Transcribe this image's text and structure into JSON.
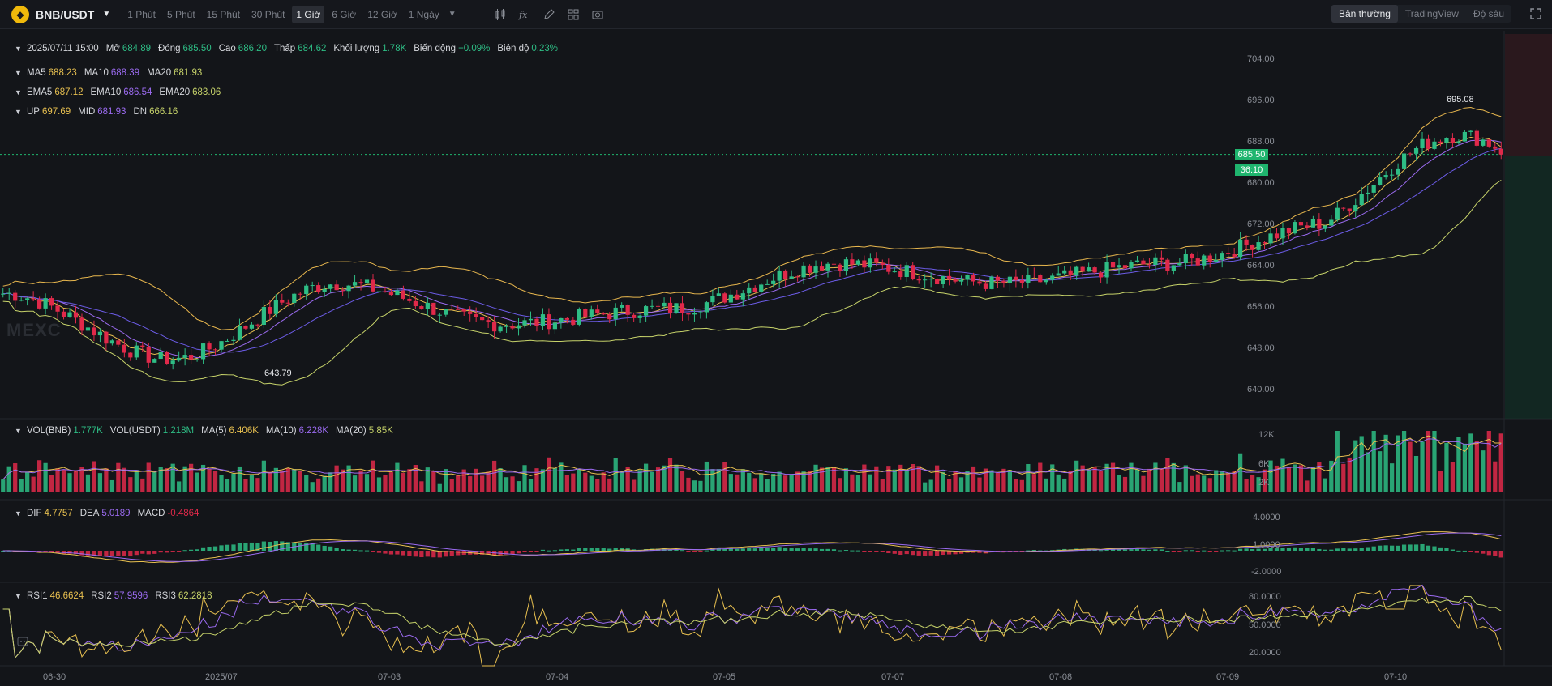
{
  "toolbar": {
    "coin_icon": "bnb-coin-icon",
    "pair": "BNB/USDT",
    "intervals": [
      {
        "label": "1 Phút",
        "active": false
      },
      {
        "label": "5 Phút",
        "active": false
      },
      {
        "label": "15 Phút",
        "active": false
      },
      {
        "label": "30 Phút",
        "active": false
      },
      {
        "label": "1 Giờ",
        "active": true
      },
      {
        "label": "6 Giờ",
        "active": false
      },
      {
        "label": "12 Giờ",
        "active": false
      },
      {
        "label": "1 Ngày",
        "active": false
      }
    ],
    "view_tabs": [
      {
        "label": "Bản thường",
        "active": true
      },
      {
        "label": "TradingView",
        "active": false
      },
      {
        "label": "Độ sâu",
        "active": false
      }
    ]
  },
  "ohlc": {
    "datetime": "2025/07/11 15:00",
    "open_label": "Mở",
    "open": "684.89",
    "close_label": "Đóng",
    "close": "685.50",
    "high_label": "Cao",
    "high": "686.20",
    "low_label": "Thấp",
    "low": "684.62",
    "volume_label": "Khối lượng",
    "volume": "1.78K",
    "change_label": "Biến động",
    "change": "+0.09%",
    "amplitude_label": "Biên độ",
    "amplitude": "0.23%"
  },
  "ma": {
    "ma5_label": "MA5",
    "ma5": "688.23",
    "ma10_label": "MA10",
    "ma10": "688.39",
    "ma20_label": "MA20",
    "ma20": "681.93"
  },
  "ema": {
    "ema5_label": "EMA5",
    "ema5": "687.12",
    "ema10_label": "EMA10",
    "ema10": "686.54",
    "ema20_label": "EMA20",
    "ema20": "683.06"
  },
  "boll": {
    "up_label": "UP",
    "up": "697.69",
    "mid_label": "MID",
    "mid": "681.93",
    "dn_label": "DN",
    "dn": "666.16"
  },
  "price_axis": [
    "704.00",
    "696.00",
    "688.00",
    "680.00",
    "672.00",
    "664.00",
    "656.00",
    "648.00",
    "640.00"
  ],
  "current_price": "685.50",
  "countdown": "36:10",
  "high_marker": "695.08",
  "low_marker": "643.79",
  "watermark": "MEXC",
  "volume": {
    "vol_bnb_label": "VOL(BNB)",
    "vol_bnb": "1.777K",
    "vol_usdt_label": "VOL(USDT)",
    "vol_usdt": "1.218M",
    "ma5_label": "MA(5)",
    "ma5": "6.406K",
    "ma10_label": "MA(10)",
    "ma10": "6.228K",
    "ma20_label": "MA(20)",
    "ma20": "5.85K",
    "axis": [
      "12K",
      "6K",
      "2K"
    ]
  },
  "macd": {
    "dif_label": "DIF",
    "dif": "4.7757",
    "dea_label": "DEA",
    "dea": "5.0189",
    "macd_label": "MACD",
    "macd": "-0.4864",
    "axis": [
      "4.0000",
      "1.0000",
      "-2.0000"
    ]
  },
  "rsi": {
    "rsi1_label": "RSI1",
    "rsi1": "46.6624",
    "rsi2_label": "RSI2",
    "rsi2": "57.9596",
    "rsi3_label": "RSI3",
    "rsi3": "62.2818",
    "axis": [
      "80.0000",
      "50.0000",
      "20.0000"
    ]
  },
  "time_axis": [
    "06-30",
    "2025/07",
    "07-03",
    "07-04",
    "07-05",
    "07-07",
    "07-08",
    "07-09",
    "07-10"
  ],
  "colors": {
    "up": "#2ebd85",
    "down": "#e0294a",
    "ma5": "#e8c050",
    "ma10": "#9b6bf0",
    "ma20": "#c7d36a",
    "boll": "#e8b74e"
  },
  "chart_data": {
    "type": "candlestick",
    "interval": "1 Giờ",
    "ylim": [
      636,
      708
    ],
    "anchors": [
      {
        "x": "06-30",
        "price": 658
      },
      {
        "x": "2025/07",
        "price": 645
      },
      {
        "x": "07-03",
        "price": 660
      },
      {
        "x": "07-04",
        "price": 652
      },
      {
        "x": "07-05",
        "price": 655
      },
      {
        "x": "07-07",
        "price": 664
      },
      {
        "x": "07-08",
        "price": 660
      },
      {
        "x": "07-09",
        "price": 664
      },
      {
        "x": "07-10",
        "price": 672
      },
      {
        "x": "07-11",
        "price": 685.5
      }
    ]
  }
}
